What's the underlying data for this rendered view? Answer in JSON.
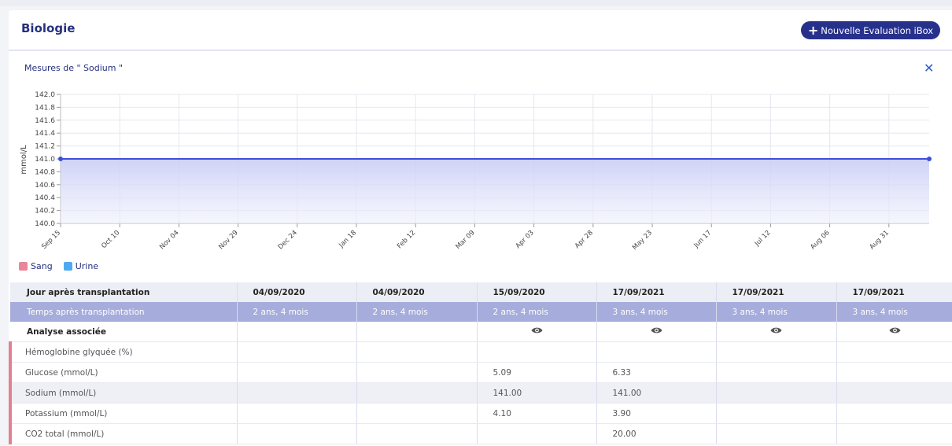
{
  "card": {
    "title": "Biologie",
    "new_button_label": "Nouvelle Evaluation iBox"
  },
  "chart_panel": {
    "title": "Mesures de \" Sodium \"",
    "close_icon": "close-icon"
  },
  "chart_data": {
    "type": "area",
    "title": "Mesures de \" Sodium \"",
    "xlabel": "",
    "ylabel": "mmol/L",
    "ylim": [
      140.0,
      142.0
    ],
    "yticks": [
      "142.0",
      "141.8",
      "141.6",
      "141.4",
      "141.2",
      "141.0",
      "140.8",
      "140.6",
      "140.4",
      "140.2",
      "140.0"
    ],
    "xticks": [
      "Sep 15",
      "Oct 10",
      "Nov 04",
      "Nov 29",
      "Dec 24",
      "Jan 18",
      "Feb 12",
      "Mar 09",
      "Apr 03",
      "Apr 28",
      "May 23",
      "Jun 17",
      "Jul 12",
      "Aug 06",
      "Aug 31"
    ],
    "xrange": [
      "2020-09-15",
      "2021-09-17"
    ],
    "series": [
      {
        "name": "Sang",
        "color": "#3d4fd8",
        "points": [
          {
            "x": "2020-09-15",
            "y": 141.0
          },
          {
            "x": "2021-09-17",
            "y": 141.0
          }
        ]
      }
    ],
    "grid": true
  },
  "legend": [
    {
      "label": "Sang",
      "color": "#e8869a"
    },
    {
      "label": "Urine",
      "color": "#4eaaf0"
    }
  ],
  "table": {
    "header_label": "Jour après transplantation",
    "dates": [
      "04/09/2020",
      "04/09/2020",
      "15/09/2020",
      "17/09/2021",
      "17/09/2021",
      "17/09/2021"
    ],
    "temps_label": "Temps après transplantation",
    "temps": [
      "2 ans, 4 mois",
      "2 ans, 4 mois",
      "2 ans, 4 mois",
      "3 ans, 4 mois",
      "3 ans, 4 mois",
      "3 ans, 4 mois"
    ],
    "analyse_label": "Analyse associée",
    "analyse_has_eye": [
      false,
      false,
      true,
      true,
      true,
      true
    ],
    "rows": [
      {
        "label": "Hémoglobine glyquée (%)",
        "values": [
          "",
          "",
          "",
          "",
          "",
          ""
        ]
      },
      {
        "label": "Glucose (mmol/L)",
        "values": [
          "",
          "",
          "5.09",
          "6.33",
          "",
          ""
        ]
      },
      {
        "label": "Sodium (mmol/L)",
        "values": [
          "",
          "",
          "141.00",
          "141.00",
          "",
          ""
        ]
      },
      {
        "label": "Potassium (mmol/L)",
        "values": [
          "",
          "",
          "4.10",
          "3.90",
          "",
          ""
        ]
      },
      {
        "label": "CO2 total (mmol/L)",
        "values": [
          "",
          "",
          "",
          "20.00",
          "",
          ""
        ]
      }
    ]
  }
}
